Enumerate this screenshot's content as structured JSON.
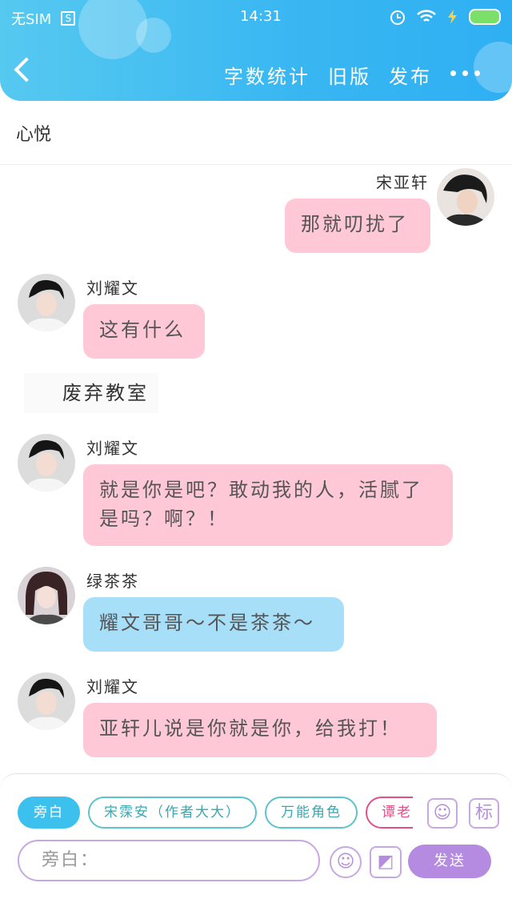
{
  "status_bar": {
    "carrier": "无SIM",
    "sim_badge": "S",
    "time": "14:31",
    "icons": [
      "alarm-icon",
      "wifi-icon",
      "charging-icon",
      "battery-icon"
    ],
    "battery_color": "#7be06a"
  },
  "nav": {
    "back_icon": "chevron-left-icon",
    "actions": [
      "字数统计",
      "旧版",
      "发布"
    ],
    "more_icon": "more-dots-icon"
  },
  "story": {
    "title": "心悦"
  },
  "messages": [
    {
      "type": "dialog",
      "side": "right",
      "name": "宋亚轩",
      "text": "那就叨扰了",
      "bubble_color": "#ffc8d6"
    },
    {
      "type": "dialog",
      "side": "left",
      "name": "刘耀文",
      "text": "这有什么",
      "bubble_color": "#ffc8d6"
    },
    {
      "type": "narration",
      "text": "废弃教室"
    },
    {
      "type": "dialog",
      "side": "left",
      "name": "刘耀文",
      "text": "就是你是吧？敢动我的人，活腻了是吗？啊？！",
      "bubble_color": "#ffc8d6"
    },
    {
      "type": "dialog",
      "side": "left",
      "name": "绿茶茶",
      "text": "耀文哥哥～不是茶茶～",
      "bubble_color": "#a7dff8"
    },
    {
      "type": "dialog",
      "side": "left",
      "name": "刘耀文",
      "text": "亚轩儿说是你就是你，给我打！",
      "bubble_color": "#ffc8d6"
    }
  ],
  "footer": {
    "role_chips": [
      "旁白",
      "宋霂安（作者大大）",
      "万能角色",
      "谭老"
    ],
    "active_chip": "旁白",
    "role_icon_label": "☺",
    "tag_icon_label": "标",
    "input_placeholder": "旁白：",
    "emoji_icon": "☺",
    "image_icon": "◩",
    "send_label": "发送",
    "accent_color": "#b48be0",
    "primary_color": "#3cc0ee"
  }
}
